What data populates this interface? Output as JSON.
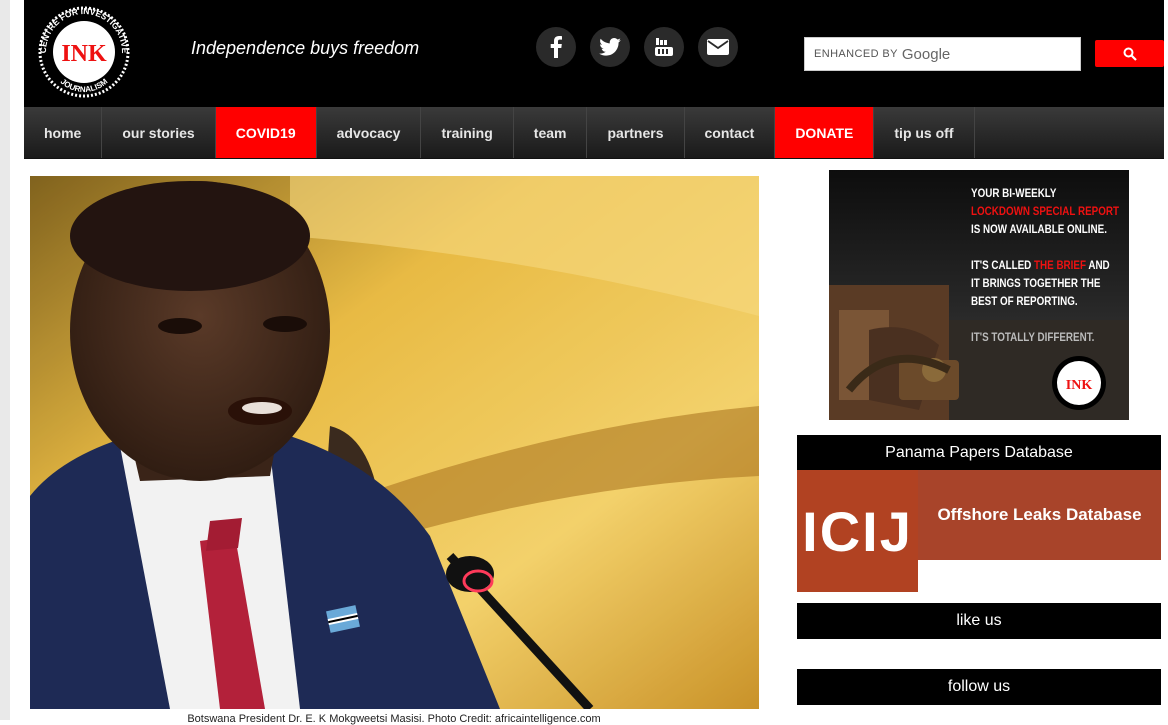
{
  "header": {
    "logo": {
      "text_top": "CENTRE FOR INVESTIGATIVE",
      "text_mid": "INK",
      "text_bottom": "JOURNALISM"
    },
    "tagline": "Independence buys freedom",
    "social": [
      "facebook-icon",
      "twitter-icon",
      "youtube-icon",
      "mail-icon"
    ],
    "search": {
      "enhanced_by": "ENHANCED BY",
      "google": "Google"
    }
  },
  "nav": {
    "items": [
      {
        "label": "home"
      },
      {
        "label": "our stories"
      },
      {
        "label": "COVID19",
        "highlight": true
      },
      {
        "label": "advocacy"
      },
      {
        "label": "training"
      },
      {
        "label": "team"
      },
      {
        "label": "partners"
      },
      {
        "label": "contact"
      },
      {
        "label": "DONATE",
        "highlight": true
      },
      {
        "label": "tip us off"
      }
    ],
    "highlight_color": "#ff0000"
  },
  "main": {
    "caption": "Botswana President Dr. E. K Mokgweetsi Masisi. Photo Credit: africaintelligence.com"
  },
  "sidebar": {
    "ad": {
      "line1": "YOUR BI-WEEKLY",
      "line2": "LOCKDOWN SPECIAL REPORT",
      "line3": "IS NOW AVAILABLE ONLINE.",
      "line4a": "IT'S CALLED ",
      "line4b": "THE BRIEF",
      "line4c": " AND",
      "line5": "IT BRINGS TOGETHER THE",
      "line6": "BEST OF REPORTING.",
      "line7": "IT'S TOTALLY DIFFERENT."
    },
    "panama_title": "Panama Papers Database",
    "icij_logo": "ICIJ",
    "offshore_title": "Offshore Leaks Database",
    "like_us": "like us",
    "follow_us": "follow us"
  },
  "colors": {
    "accent": "#ff0000",
    "header_bg": "#000000",
    "icij_brown": "#b14222"
  }
}
